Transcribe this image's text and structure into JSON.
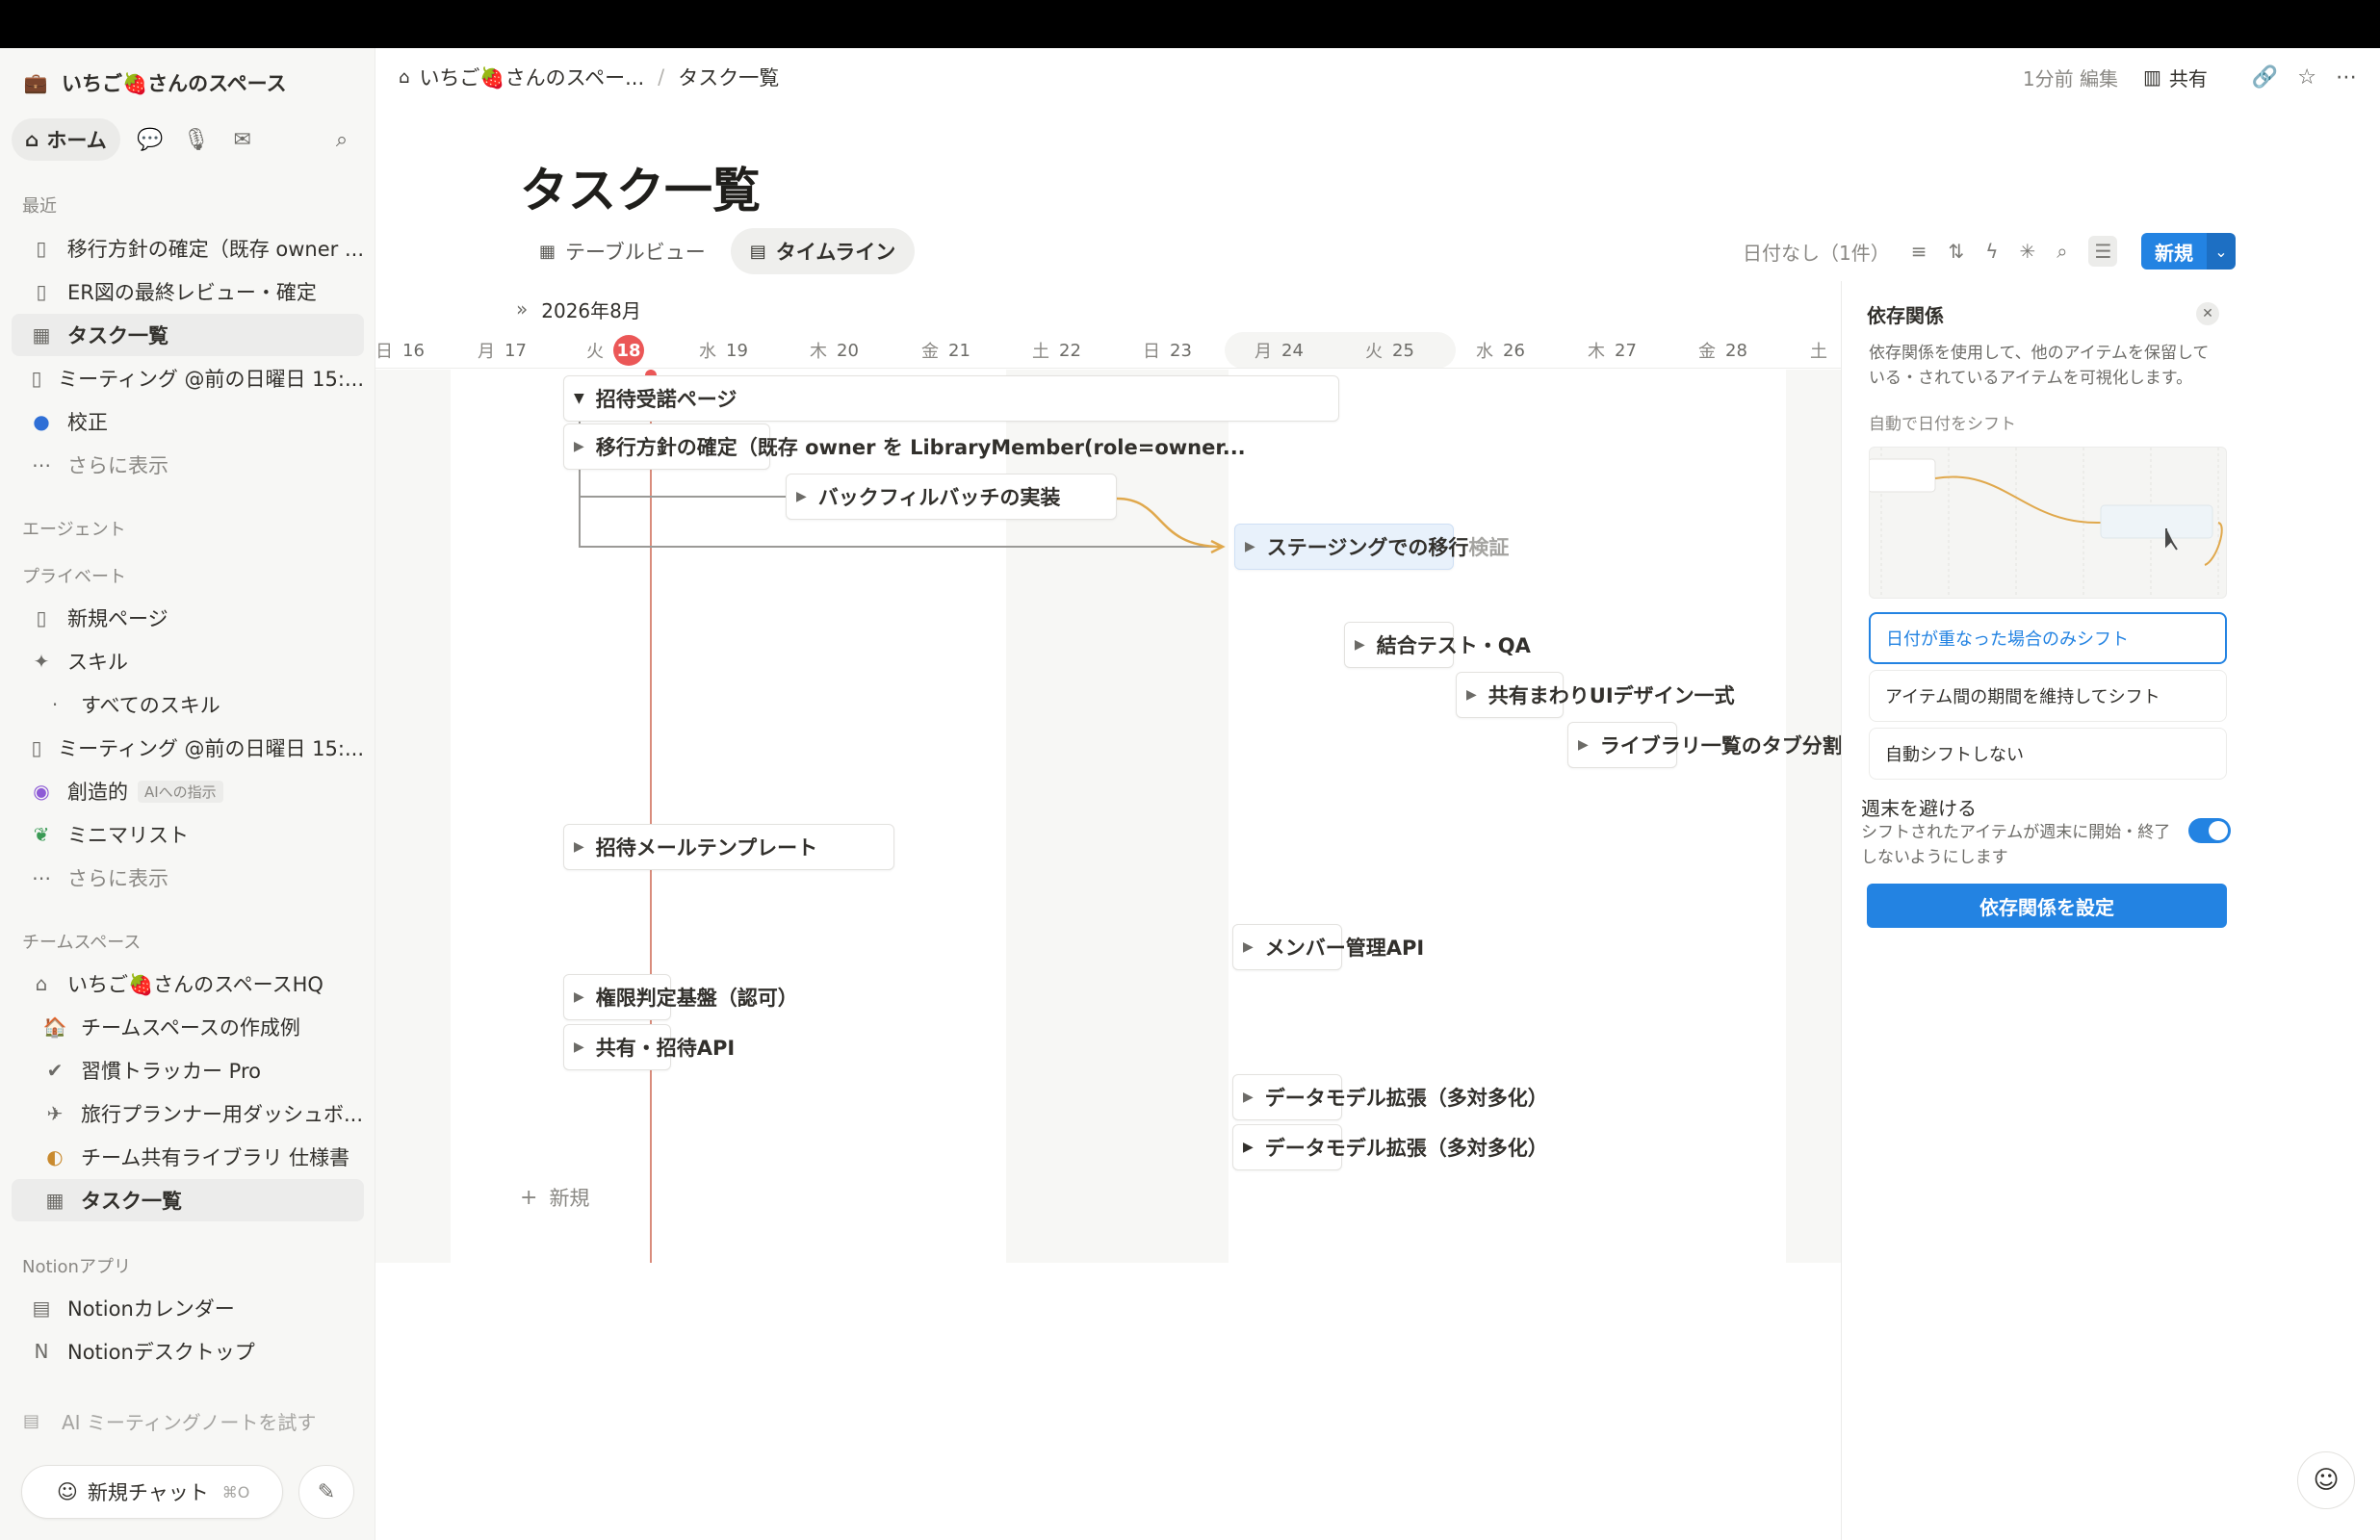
{
  "sidebar": {
    "workspace": "いちご🍓さんのスペース",
    "home": "ホーム",
    "recent_label": "最近",
    "recent": [
      {
        "label": "移行方針の確定（既存 owner ...",
        "icon": "page-icon"
      },
      {
        "label": "ER図の最終レビュー・確定",
        "icon": "page-icon"
      },
      {
        "label": "タスク一覧",
        "icon": "table-icon"
      },
      {
        "label": "ミーティング @前の日曜日 15:...",
        "icon": "page-icon"
      },
      {
        "label": "校正",
        "icon": "check-circle-icon"
      },
      {
        "label": "さらに表示",
        "icon": "more-icon"
      }
    ],
    "agent_label": "エージェント",
    "private_label": "プライベート",
    "private": [
      {
        "label": "新規ページ",
        "icon": "page-icon"
      },
      {
        "label": "スキル",
        "icon": "magic-wand-icon"
      },
      {
        "label": "すべてのスキル",
        "icon": "dot-icon"
      },
      {
        "label": "ミーティング @前の日曜日 15:...",
        "icon": "page-icon"
      },
      {
        "label": "創造的",
        "icon": "palette-icon",
        "tag": "AIへの指示"
      },
      {
        "label": "ミニマリスト",
        "icon": "leaf-icon"
      },
      {
        "label": "さらに表示",
        "icon": "more-icon"
      }
    ],
    "teamspace_label": "チームスペース",
    "teamspace": [
      {
        "label": "いちご🍓さんのスペースHQ",
        "icon": "home-icon"
      },
      {
        "label": "チームスペースの作成例",
        "icon": "house-icon"
      },
      {
        "label": "習慣トラッカー Pro",
        "icon": "check-badge-icon"
      },
      {
        "label": "旅行プランナー用ダッシュボ...",
        "icon": "airplane-icon"
      },
      {
        "label": "チーム共有ライブラリ 仕様書",
        "icon": "book-icon"
      },
      {
        "label": "タスク一覧",
        "icon": "table-icon"
      }
    ],
    "apps_label": "Notionアプリ",
    "apps": [
      {
        "label": "Notionカレンダー",
        "icon": "calendar-icon"
      },
      {
        "label": "Notionデスクトップ",
        "icon": "notion-icon"
      }
    ],
    "ai_meeting": "AI ミーティングノートを試す",
    "new_chat": "新規チャット",
    "new_chat_shortcut": "⌘O"
  },
  "header": {
    "breadcrumb_root": "いちご🍓さんのスペー...",
    "breadcrumb_current": "タスク一覧",
    "edited": "1分前 編集",
    "share": "共有"
  },
  "page": {
    "title": "タスク一覧",
    "tabs": [
      "テーブルビュー",
      "タイムライン"
    ],
    "no_date": "日付なし（1件）",
    "new_button": "新規",
    "add_new": "新規"
  },
  "timeline": {
    "month": "2026年8月",
    "today": "18",
    "days": [
      {
        "w": "日",
        "d": "16"
      },
      {
        "w": "月",
        "d": "17"
      },
      {
        "w": "火",
        "d": "18"
      },
      {
        "w": "水",
        "d": "19"
      },
      {
        "w": "木",
        "d": "20"
      },
      {
        "w": "金",
        "d": "21"
      },
      {
        "w": "土",
        "d": "22"
      },
      {
        "w": "日",
        "d": "23"
      },
      {
        "w": "月",
        "d": "24"
      },
      {
        "w": "火",
        "d": "25"
      },
      {
        "w": "水",
        "d": "26"
      },
      {
        "w": "木",
        "d": "27"
      },
      {
        "w": "金",
        "d": "28"
      },
      {
        "w": "土",
        "d": ""
      }
    ],
    "tasks": [
      {
        "label": "招待受諾ページ",
        "expanded": true
      },
      {
        "label": "移行方針の確定（既存 owner を LibraryMember(role=owner..."
      },
      {
        "label": "バックフィルバッチの実装"
      },
      {
        "label": "ステージングでの移行",
        "ghost": "検証"
      },
      {
        "label": "結合テスト・QA"
      },
      {
        "label": "共有まわりUIデザイン一式"
      },
      {
        "label": "ライブラリ一覧のタブ分割"
      },
      {
        "label": "招待メールテンプレート"
      },
      {
        "label": "メンバー管理API"
      },
      {
        "label": "権限判定基盤（認可）"
      },
      {
        "label": "共有・招待API"
      },
      {
        "label": "データモデル拡張（多対多化）"
      },
      {
        "label": "データモデル拡張（多対多化）"
      }
    ]
  },
  "panel": {
    "title": "依存関係",
    "desc": "依存関係を使用して、他のアイテムを保留している・されているアイテムを可視化します。",
    "auto_shift": "自動で日付をシフト",
    "options": [
      "日付が重なった場合のみシフト",
      "アイテム間の期間を維持してシフト",
      "自動シフトしない"
    ],
    "selected_option": 0,
    "weekend_title": "週末を避ける",
    "weekend_desc": "シフトされたアイテムが週末に開始・終了しないようにします",
    "weekend_on": true,
    "set_button": "依存関係を設定"
  },
  "colors": {
    "accent": "#2383e2",
    "today": "#eb5757",
    "dependency": "#e0a84c"
  }
}
